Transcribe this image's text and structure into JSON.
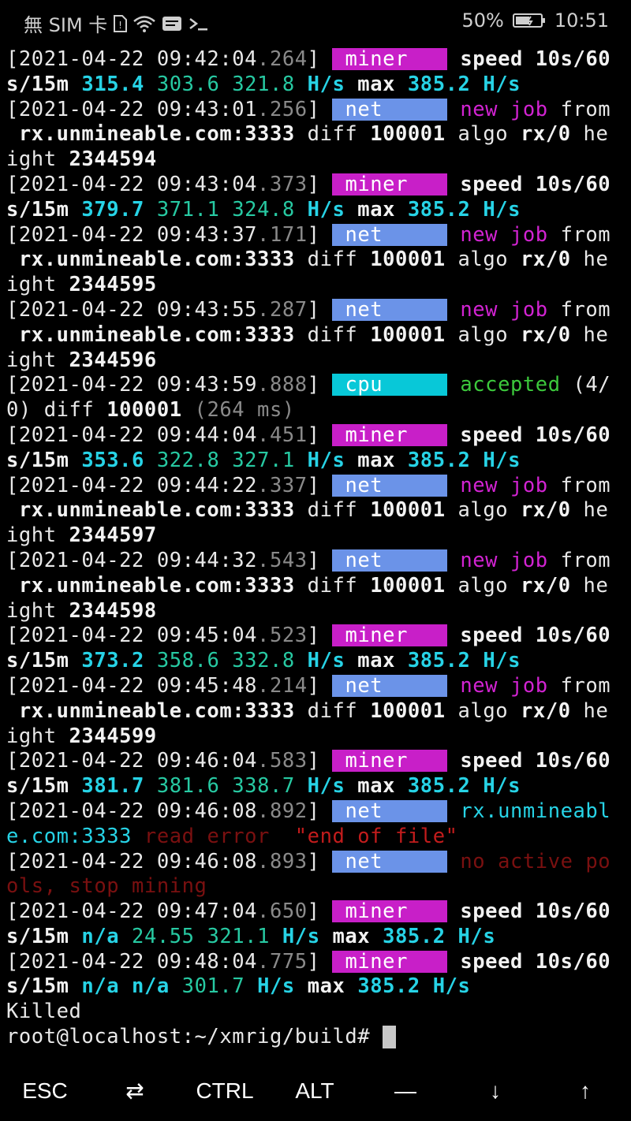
{
  "statusbar": {
    "carrier": "無 SIM 卡",
    "battery_pct": "50%",
    "time": "10:51"
  },
  "terminal": {
    "lines": [
      [
        [
          "[2021-04-22 09:42:04",
          ""
        ],
        [
          ".264",
          "ms"
        ],
        [
          "] ",
          ""
        ],
        [
          "miner",
          "badge b-miner"
        ],
        [
          " speed 10s/60",
          "bold"
        ]
      ],
      [
        [
          "s/15m ",
          "bold"
        ],
        [
          "315.4",
          "cyan"
        ],
        [
          " ",
          ""
        ],
        [
          "303.6",
          "green"
        ],
        [
          " ",
          ""
        ],
        [
          "321.8",
          "green"
        ],
        [
          " H/s",
          "cyan"
        ],
        [
          " max ",
          "bold"
        ],
        [
          "385.2 H/s",
          "cyan"
        ]
      ],
      [
        [
          "[2021-04-22 09:43:01",
          ""
        ],
        [
          ".256",
          "ms"
        ],
        [
          "] ",
          ""
        ],
        [
          "net",
          "badge b-net"
        ],
        [
          " ",
          ""
        ],
        [
          "new job",
          "magenta"
        ],
        [
          " from",
          ""
        ]
      ],
      [
        [
          " rx.unmineable.com:3333",
          "bold"
        ],
        [
          " diff ",
          ""
        ],
        [
          "100001",
          "bold"
        ],
        [
          " algo ",
          ""
        ],
        [
          "rx/0",
          "bold"
        ],
        [
          " he",
          ""
        ]
      ],
      [
        [
          "ight ",
          ""
        ],
        [
          "2344594",
          "bold"
        ]
      ],
      [
        [
          "[2021-04-22 09:43:04",
          ""
        ],
        [
          ".373",
          "ms"
        ],
        [
          "] ",
          ""
        ],
        [
          "miner",
          "badge b-miner"
        ],
        [
          " speed 10s/60",
          "bold"
        ]
      ],
      [
        [
          "s/15m ",
          "bold"
        ],
        [
          "379.7",
          "cyan"
        ],
        [
          " ",
          ""
        ],
        [
          "371.1",
          "green"
        ],
        [
          " ",
          ""
        ],
        [
          "324.8",
          "green"
        ],
        [
          " H/s",
          "cyan"
        ],
        [
          " max ",
          "bold"
        ],
        [
          "385.2 H/s",
          "cyan"
        ]
      ],
      [
        [
          "[2021-04-22 09:43:37",
          ""
        ],
        [
          ".171",
          "ms"
        ],
        [
          "] ",
          ""
        ],
        [
          "net",
          "badge b-net"
        ],
        [
          " ",
          ""
        ],
        [
          "new job",
          "magenta"
        ],
        [
          " from",
          ""
        ]
      ],
      [
        [
          " rx.unmineable.com:3333",
          "bold"
        ],
        [
          " diff ",
          ""
        ],
        [
          "100001",
          "bold"
        ],
        [
          " algo ",
          ""
        ],
        [
          "rx/0",
          "bold"
        ],
        [
          " he",
          ""
        ]
      ],
      [
        [
          "ight ",
          ""
        ],
        [
          "2344595",
          "bold"
        ]
      ],
      [
        [
          "[2021-04-22 09:43:55",
          ""
        ],
        [
          ".287",
          "ms"
        ],
        [
          "] ",
          ""
        ],
        [
          "net",
          "badge b-net"
        ],
        [
          " ",
          ""
        ],
        [
          "new job",
          "magenta"
        ],
        [
          " from",
          ""
        ]
      ],
      [
        [
          " rx.unmineable.com:3333",
          "bold"
        ],
        [
          " diff ",
          ""
        ],
        [
          "100001",
          "bold"
        ],
        [
          " algo ",
          ""
        ],
        [
          "rx/0",
          "bold"
        ],
        [
          " he",
          ""
        ]
      ],
      [
        [
          "ight ",
          ""
        ],
        [
          "2344596",
          "bold"
        ]
      ],
      [
        [
          "[2021-04-22 09:43:59",
          ""
        ],
        [
          ".888",
          "ms"
        ],
        [
          "] ",
          ""
        ],
        [
          "cpu",
          "badge b-cpu"
        ],
        [
          " ",
          ""
        ],
        [
          "accepted",
          "green2"
        ],
        [
          " (4/",
          ""
        ]
      ],
      [
        [
          "0) diff ",
          ""
        ],
        [
          "100001",
          "bold"
        ],
        [
          " (264 ms)",
          "gray"
        ]
      ],
      [
        [
          "[2021-04-22 09:44:04",
          ""
        ],
        [
          ".451",
          "ms"
        ],
        [
          "] ",
          ""
        ],
        [
          "miner",
          "badge b-miner"
        ],
        [
          " speed 10s/60",
          "bold"
        ]
      ],
      [
        [
          "s/15m ",
          "bold"
        ],
        [
          "353.6",
          "cyan"
        ],
        [
          " ",
          ""
        ],
        [
          "322.8",
          "green"
        ],
        [
          " ",
          ""
        ],
        [
          "327.1",
          "green"
        ],
        [
          " H/s",
          "cyan"
        ],
        [
          " max ",
          "bold"
        ],
        [
          "385.2 H/s",
          "cyan"
        ]
      ],
      [
        [
          "[2021-04-22 09:44:22",
          ""
        ],
        [
          ".337",
          "ms"
        ],
        [
          "] ",
          ""
        ],
        [
          "net",
          "badge b-net"
        ],
        [
          " ",
          ""
        ],
        [
          "new job",
          "magenta"
        ],
        [
          " from",
          ""
        ]
      ],
      [
        [
          " rx.unmineable.com:3333",
          "bold"
        ],
        [
          " diff ",
          ""
        ],
        [
          "100001",
          "bold"
        ],
        [
          " algo ",
          ""
        ],
        [
          "rx/0",
          "bold"
        ],
        [
          " he",
          ""
        ]
      ],
      [
        [
          "ight ",
          ""
        ],
        [
          "2344597",
          "bold"
        ]
      ],
      [
        [
          "[2021-04-22 09:44:32",
          ""
        ],
        [
          ".543",
          "ms"
        ],
        [
          "] ",
          ""
        ],
        [
          "net",
          "badge b-net"
        ],
        [
          " ",
          ""
        ],
        [
          "new job",
          "magenta"
        ],
        [
          " from",
          ""
        ]
      ],
      [
        [
          " rx.unmineable.com:3333",
          "bold"
        ],
        [
          " diff ",
          ""
        ],
        [
          "100001",
          "bold"
        ],
        [
          " algo ",
          ""
        ],
        [
          "rx/0",
          "bold"
        ],
        [
          " he",
          ""
        ]
      ],
      [
        [
          "ight ",
          ""
        ],
        [
          "2344598",
          "bold"
        ]
      ],
      [
        [
          "[2021-04-22 09:45:04",
          ""
        ],
        [
          ".523",
          "ms"
        ],
        [
          "] ",
          ""
        ],
        [
          "miner",
          "badge b-miner"
        ],
        [
          " speed 10s/60",
          "bold"
        ]
      ],
      [
        [
          "s/15m ",
          "bold"
        ],
        [
          "373.2",
          "cyan"
        ],
        [
          " ",
          ""
        ],
        [
          "358.6",
          "green"
        ],
        [
          " ",
          ""
        ],
        [
          "332.8",
          "green"
        ],
        [
          " H/s",
          "cyan"
        ],
        [
          " max ",
          "bold"
        ],
        [
          "385.2 H/s",
          "cyan"
        ]
      ],
      [
        [
          "[2021-04-22 09:45:48",
          ""
        ],
        [
          ".214",
          "ms"
        ],
        [
          "] ",
          ""
        ],
        [
          "net",
          "badge b-net"
        ],
        [
          " ",
          ""
        ],
        [
          "new job",
          "magenta"
        ],
        [
          " from",
          ""
        ]
      ],
      [
        [
          " rx.unmineable.com:3333",
          "bold"
        ],
        [
          " diff ",
          ""
        ],
        [
          "100001",
          "bold"
        ],
        [
          " algo ",
          ""
        ],
        [
          "rx/0",
          "bold"
        ],
        [
          " he",
          ""
        ]
      ],
      [
        [
          "ight ",
          ""
        ],
        [
          "2344599",
          "bold"
        ]
      ],
      [
        [
          "[2021-04-22 09:46:04",
          ""
        ],
        [
          ".583",
          "ms"
        ],
        [
          "] ",
          ""
        ],
        [
          "miner",
          "badge b-miner"
        ],
        [
          " speed 10s/60",
          "bold"
        ]
      ],
      [
        [
          "s/15m ",
          "bold"
        ],
        [
          "381.7",
          "cyan"
        ],
        [
          " ",
          ""
        ],
        [
          "381.6",
          "green"
        ],
        [
          " ",
          ""
        ],
        [
          "338.7",
          "green"
        ],
        [
          " H/s",
          "cyan"
        ],
        [
          " max ",
          "bold"
        ],
        [
          "385.2 H/s",
          "cyan"
        ]
      ],
      [
        [
          "[2021-04-22 09:46:08",
          ""
        ],
        [
          ".892",
          "ms"
        ],
        [
          "] ",
          ""
        ],
        [
          "net",
          "badge b-net"
        ],
        [
          " ",
          ""
        ],
        [
          "rx.unmineabl",
          "teal"
        ]
      ],
      [
        [
          "e.com:3333",
          "teal"
        ],
        [
          " read error ",
          "dred"
        ],
        [
          " ",
          ""
        ],
        [
          "\"end of file\"",
          "red"
        ]
      ],
      [
        [
          "[2021-04-22 09:46:08",
          ""
        ],
        [
          ".893",
          "ms"
        ],
        [
          "] ",
          ""
        ],
        [
          "net",
          "badge b-net"
        ],
        [
          " ",
          ""
        ],
        [
          "no active po",
          "dred"
        ]
      ],
      [
        [
          "ols, stop mining",
          "dred"
        ]
      ],
      [
        [
          "[2021-04-22 09:47:04",
          ""
        ],
        [
          ".650",
          "ms"
        ],
        [
          "] ",
          ""
        ],
        [
          "miner",
          "badge b-miner"
        ],
        [
          " speed 10s/60",
          "bold"
        ]
      ],
      [
        [
          "s/15m ",
          "bold"
        ],
        [
          "n/a",
          "cyan"
        ],
        [
          " ",
          ""
        ],
        [
          "24.55",
          "green"
        ],
        [
          " ",
          ""
        ],
        [
          "321.1",
          "green"
        ],
        [
          " H/s",
          "cyan"
        ],
        [
          " max ",
          "bold"
        ],
        [
          "385.2 H/s",
          "cyan"
        ]
      ],
      [
        [
          "[2021-04-22 09:48:04",
          ""
        ],
        [
          ".775",
          "ms"
        ],
        [
          "] ",
          ""
        ],
        [
          "miner",
          "badge b-miner"
        ],
        [
          " speed 10s/60",
          "bold"
        ]
      ],
      [
        [
          "s/15m ",
          "bold"
        ],
        [
          "n/a",
          "cyan"
        ],
        [
          " ",
          ""
        ],
        [
          "n/a",
          "cyan"
        ],
        [
          " ",
          ""
        ],
        [
          "301.7",
          "green"
        ],
        [
          " H/s",
          "cyan"
        ],
        [
          " max ",
          "bold"
        ],
        [
          "385.2 H/s",
          "cyan"
        ]
      ],
      [
        [
          "Killed",
          ""
        ]
      ],
      [
        [
          "root@localhost:~/xmrig/build# ",
          ""
        ]
      ]
    ]
  },
  "extra_keys": [
    {
      "name": "esc-key",
      "label": "ESC"
    },
    {
      "name": "tab-key",
      "label": "⇄"
    },
    {
      "name": "ctrl-key",
      "label": "CTRL"
    },
    {
      "name": "alt-key",
      "label": "ALT"
    },
    {
      "name": "dash-key",
      "label": "—"
    },
    {
      "name": "down-arrow-key",
      "label": "↓"
    },
    {
      "name": "up-arrow-key",
      "label": "↑"
    }
  ],
  "colors": {
    "miner": "#c81fc8",
    "net": "#6b93e8",
    "cpu": "#08c8d8"
  },
  "icons": [
    "sim-card-icon",
    "wifi-icon",
    "message-icon",
    "terminal-icon",
    "battery-icon"
  ]
}
